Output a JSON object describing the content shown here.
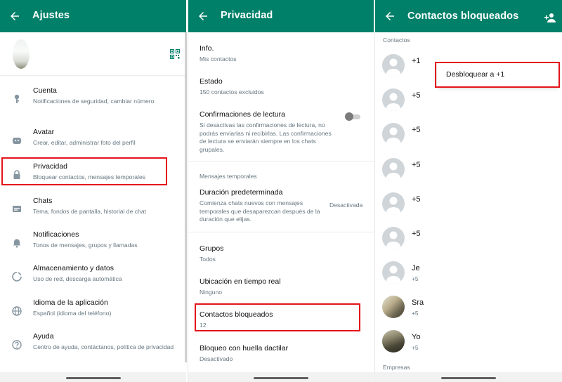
{
  "colors": {
    "appbar": "#008069",
    "highlight": "#e3141b",
    "secondary_text": "#667781"
  },
  "settings": {
    "title": "Ajustes",
    "items": [
      {
        "label": "Cuenta",
        "sub": "Notificaciones de seguridad, cambiar número",
        "icon": "key-icon"
      },
      {
        "label": "Avatar",
        "sub": "Crear, editar, administrar foto del perfil",
        "icon": "avatar-face-icon"
      },
      {
        "label": "Privacidad",
        "sub": "Bloquear contactos, mensajes temporales",
        "icon": "lock-icon"
      },
      {
        "label": "Chats",
        "sub": "Tema, fondos de pantalla, historial de chat",
        "icon": "chat-icon"
      },
      {
        "label": "Notificaciones",
        "sub": "Tonos de mensajes, grupos y llamadas",
        "icon": "bell-icon"
      },
      {
        "label": "Almacenamiento y datos",
        "sub": "Uso de red, descarga automática",
        "icon": "data-usage-icon"
      },
      {
        "label": "Idioma de la aplicación",
        "sub": "Español (idioma del teléfono)",
        "icon": "globe-icon"
      },
      {
        "label": "Ayuda",
        "sub": "Centro de ayuda, contáctanos, política de privacidad",
        "icon": "help-icon"
      }
    ]
  },
  "privacy": {
    "title": "Privacidad",
    "info": {
      "label": "Info.",
      "sub": "Mis contactos"
    },
    "status": {
      "label": "Estado",
      "sub": "150 contactos excluidos"
    },
    "read_receipts": {
      "label": "Confirmaciones de lectura",
      "sub": "Si desactivas las confirmaciones de lectura, no podrás enviarlas ni recibirlas. Las confirmaciones de lectura se enviarán siempre en los chats grupales.",
      "enabled": false
    },
    "temp_section": "Mensajes temporales",
    "default_duration": {
      "label": "Duración predeterminada",
      "sub": "Comienza chats nuevos con mensajes temporales que desaparezcan después de la duración que elijas.",
      "value": "Desactivada"
    },
    "groups": {
      "label": "Grupos",
      "sub": "Todos"
    },
    "live_location": {
      "label": "Ubicación en tiempo real",
      "sub": "Ninguno"
    },
    "blocked": {
      "label": "Contactos bloqueados",
      "sub": "12"
    },
    "fingerprint": {
      "label": "Bloqueo con huella dactilar",
      "sub": "Desactivado"
    }
  },
  "blocked_contacts": {
    "title": "Contactos bloqueados",
    "section": "Contactos",
    "contacts": [
      {
        "name": "+1",
        "sub": ""
      },
      {
        "name": "+5",
        "sub": ""
      },
      {
        "name": "+5",
        "sub": ""
      },
      {
        "name": "+5",
        "sub": ""
      },
      {
        "name": "+5",
        "sub": ""
      },
      {
        "name": "+5",
        "sub": ""
      },
      {
        "name": "Je",
        "sub": "+5"
      },
      {
        "name": "Sra",
        "sub": "+5"
      },
      {
        "name": "Yo",
        "sub": "+5"
      }
    ],
    "section2": "Empresas",
    "popup_label": "Desbloquear a +1"
  }
}
